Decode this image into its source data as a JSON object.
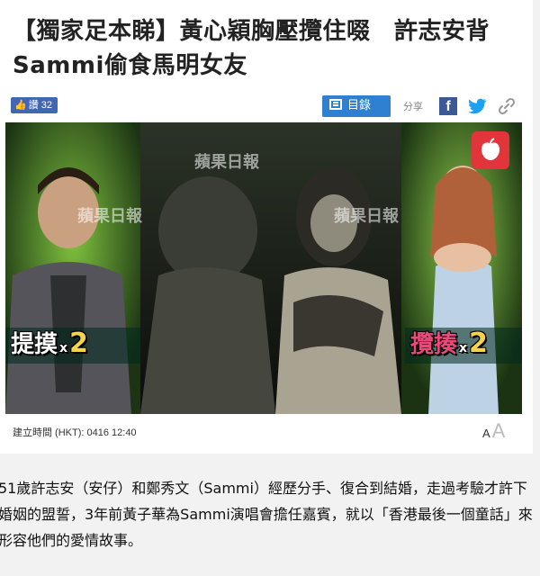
{
  "article": {
    "headline": "【獨家足本睇】黃心穎胸壓攬住啜　許志安背Sammi偷食馬明女友",
    "published_label": "建立時間 (HKT): 0416 12:40",
    "body": "51歲許志安（安仔）和鄭秀文（Sammi）經歷分手、復合到結婚，走過考驗才許下婚姻的盟誓，3年前黃子華為Sammi演唱會擔任嘉賓，就以「香港最後一個童話」來形容他們的愛情故事。"
  },
  "toolbar": {
    "like_label": "讚",
    "like_count": "32",
    "toc_label": "目錄",
    "share_label": "分享",
    "facebook_icon": "facebook-icon",
    "twitter_icon": "twitter-icon",
    "link_icon": "link-icon"
  },
  "photo": {
    "watermark": "蘋果日報",
    "left_tag": "提摸",
    "left_multiplier": "x",
    "left_count": "2",
    "right_tag": "攬揍",
    "right_multiplier": "x",
    "right_count": "2"
  },
  "font_control": {
    "small": "A",
    "large": "A"
  },
  "colors": {
    "facebook": "#3b5998",
    "twitter": "#1da1f2",
    "toc": "#2f80d1",
    "brand_red": "#e2343b"
  }
}
